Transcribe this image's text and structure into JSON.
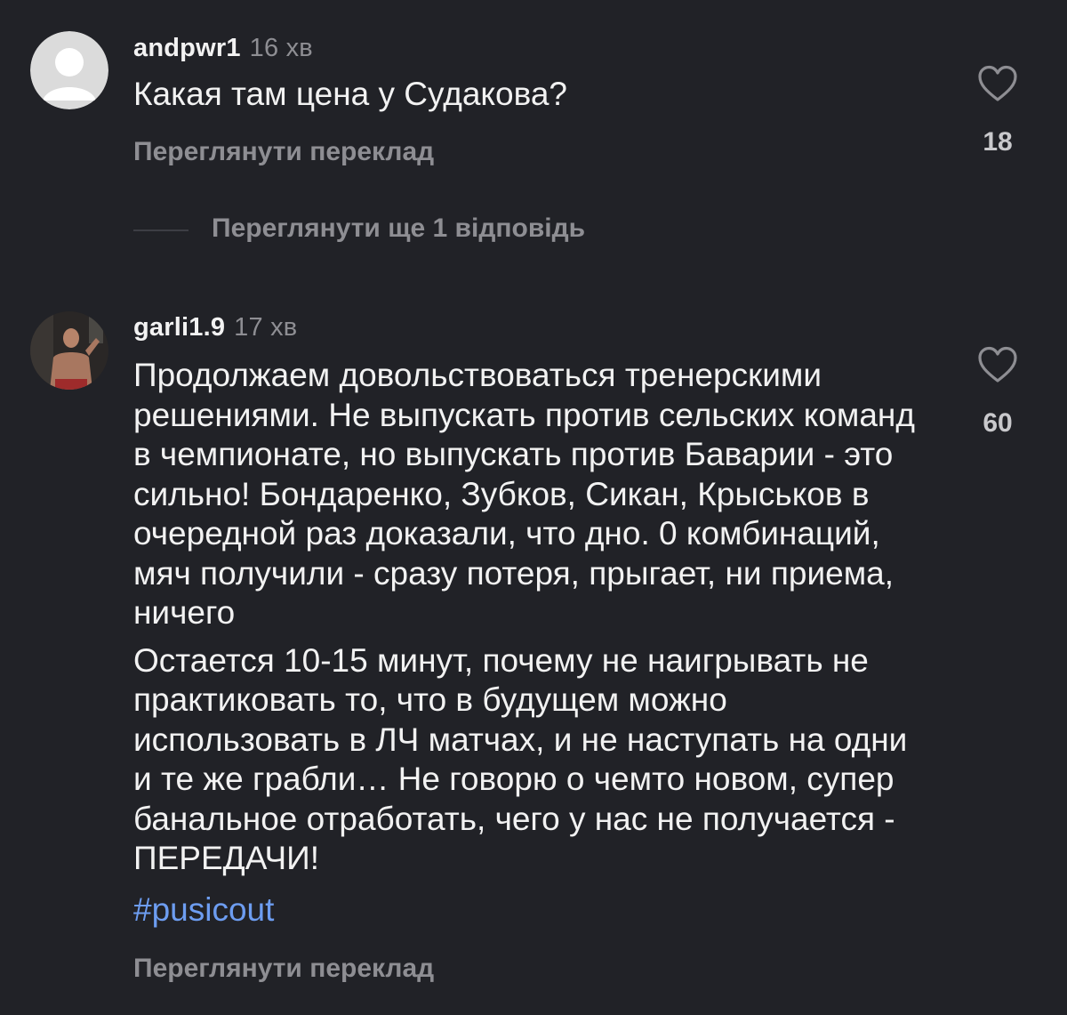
{
  "comments": [
    {
      "username": "andpwr1",
      "time": "16 хв",
      "text": [
        "Какая там цена у Судакова?"
      ],
      "translate_label": "Переглянути переклад",
      "likes": "18",
      "avatar": "default-user-avatar",
      "view_replies_label": "Переглянути ще 1 відповідь"
    },
    {
      "username": "garli1.9",
      "time": "17 хв",
      "text": [
        "Продолжаем довольствоваться тренерскими решениями. Не выпускать против сельских команд в чемпионате, но выпускать против Баварии - это сильно! Бондаренко, Зубков, Сикан, Крыськов в очередной раз доказали, что дно. 0 комбинаций, мяч получили - сразу потеря, прыгает, ни приема, ничего",
        "Остается 10-15 минут, почему не наигрывать не практиковать то, что в будущем можно использовать в ЛЧ матчах, и не наступать на одни и те же грабли… Не говорю о чемто новом, супер банальное отработать, чего у нас не получается - ПЕРЕДАЧИ!"
      ],
      "hashtag": "#pusicout",
      "translate_label": "Переглянути переклад",
      "likes": "60",
      "avatar": "user-photo-avatar"
    }
  ],
  "colors": {
    "background": "#212227",
    "text": "#f2f2f2",
    "muted": "#8e8e93",
    "hashtag": "#6d9df1"
  },
  "icons": {
    "like": "heart-outline-icon"
  }
}
